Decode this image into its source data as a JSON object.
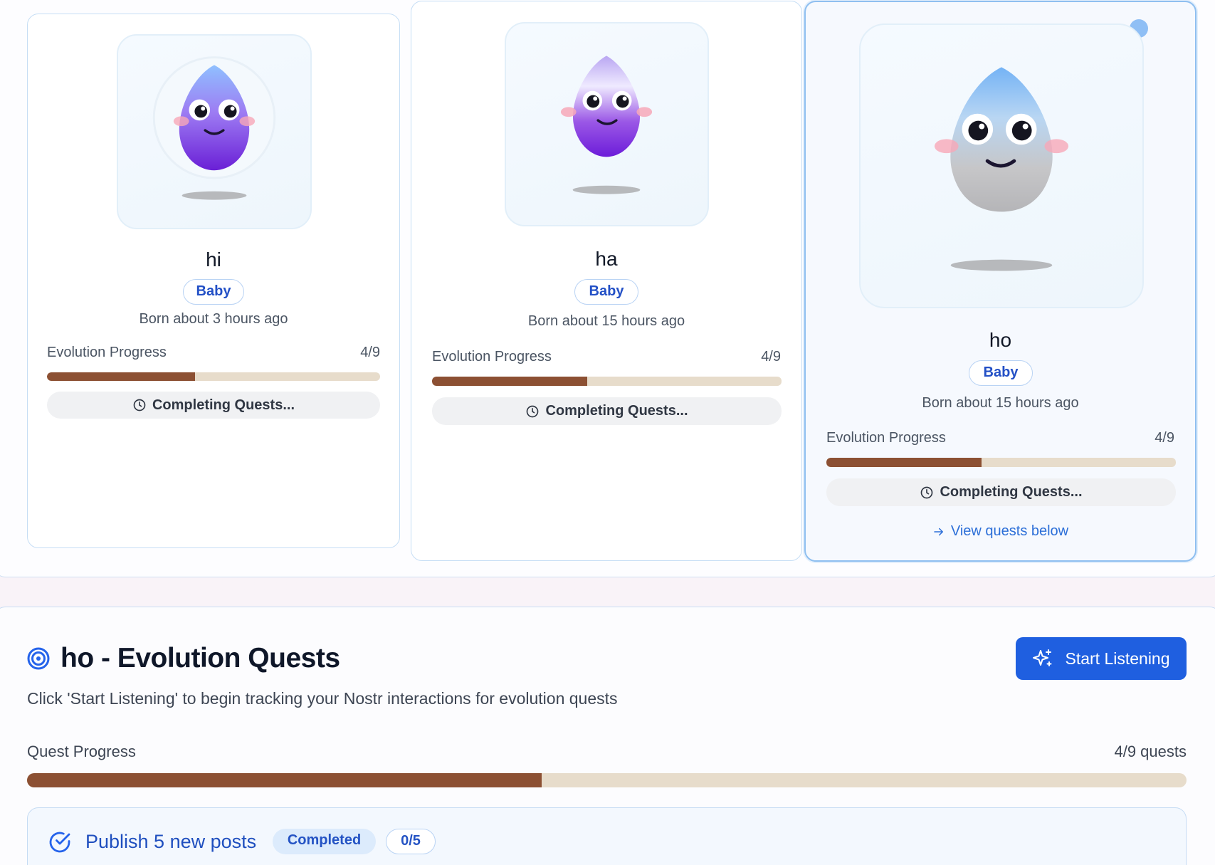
{
  "colors": {
    "accent": "#1f5fe0",
    "progress_fill": "#8c5033",
    "progress_track": "#e7dccb",
    "badge_text": "#2350c6",
    "link": "#2c6fd8"
  },
  "pets": [
    {
      "name": "hi",
      "stage": "Baby",
      "born": "Born about 3 hours ago",
      "progress_label": "Evolution Progress",
      "progress_count": "4/9",
      "progress_fraction": 0.444,
      "status": "Completing Quests...",
      "status_icon": "clock-icon",
      "selected": false
    },
    {
      "name": "ha",
      "stage": "Baby",
      "born": "Born about 15 hours ago",
      "progress_label": "Evolution Progress",
      "progress_count": "4/9",
      "progress_fraction": 0.444,
      "status": "Completing Quests...",
      "status_icon": "clock-icon",
      "selected": false
    },
    {
      "name": "ho",
      "stage": "Baby",
      "born": "Born about 15 hours ago",
      "progress_label": "Evolution Progress",
      "progress_count": "4/9",
      "progress_fraction": 0.444,
      "status": "Completing Quests...",
      "status_icon": "clock-icon",
      "selected": true,
      "link": "View quests below",
      "link_icon": "arrow-right-icon"
    }
  ],
  "quests": {
    "title": "ho - Evolution Quests",
    "title_icon": "target-icon",
    "start_button": "Start Listening",
    "start_button_icon": "sparkles-icon",
    "description": "Click 'Start Listening' to begin tracking your Nostr interactions for evolution quests",
    "progress_label": "Quest Progress",
    "progress_count": "4/9 quests",
    "progress_fraction": 0.444,
    "items": [
      {
        "name": "Publish 5 new posts",
        "icon": "check-circle-icon",
        "badge": "Completed",
        "count": "0/5"
      }
    ]
  }
}
